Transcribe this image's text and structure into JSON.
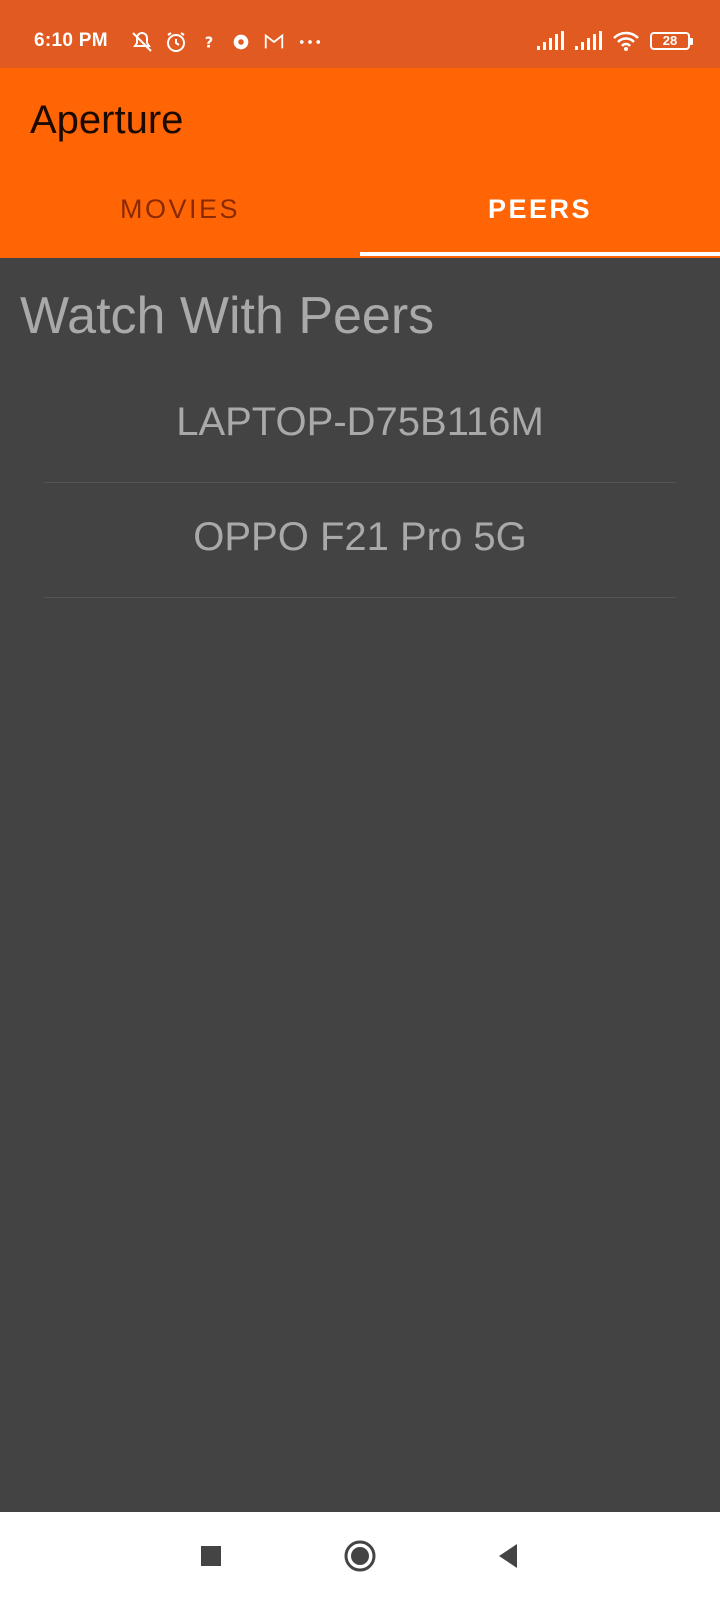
{
  "status_bar": {
    "time": "6:10 PM",
    "battery_level": "28",
    "left_icons": [
      "mute-icon",
      "alarm-icon",
      "wifi-question-icon",
      "record-icon",
      "gmail-icon",
      "more-dots-icon"
    ],
    "right_icons": [
      "signal-icon",
      "signal-icon",
      "wifi-icon",
      "battery-icon"
    ]
  },
  "app_bar": {
    "title": "Aperture",
    "background_color": "#ff6505"
  },
  "tabs": [
    {
      "label": "MOVIES",
      "selected": false
    },
    {
      "label": "PEERS",
      "selected": true
    }
  ],
  "main": {
    "title": "Watch With Peers",
    "peers": [
      {
        "name": "LAPTOP-D75B116M"
      },
      {
        "name": "OPPO F21 Pro 5G"
      }
    ]
  },
  "nav_bar": {
    "buttons": [
      "recents-icon",
      "home-icon",
      "back-icon"
    ]
  }
}
